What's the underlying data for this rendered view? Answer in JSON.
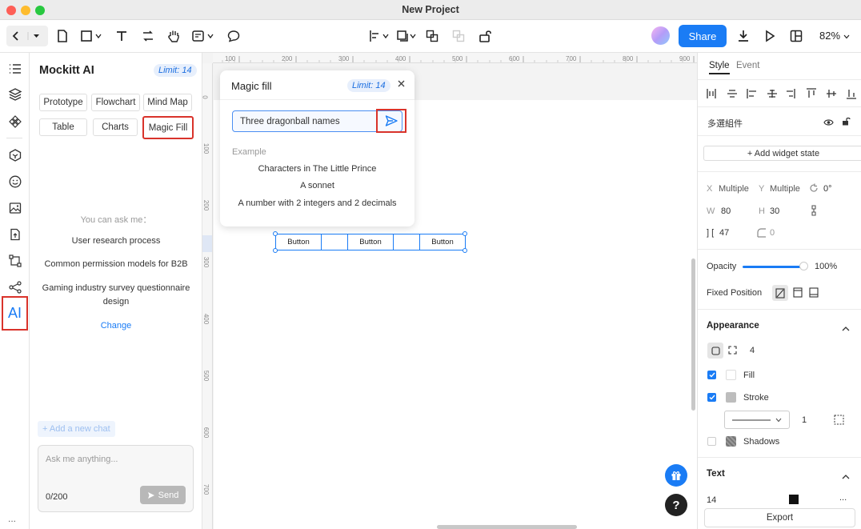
{
  "window": {
    "title": "New Project"
  },
  "toolbar": {
    "share_label": "Share",
    "zoom": "82%"
  },
  "ai_panel": {
    "title": "Mockitt AI",
    "limit": "Limit: 14",
    "tags": [
      "Prototype",
      "Flowchart",
      "Mind Map",
      "Table",
      "Charts",
      "Magic Fill"
    ],
    "hint_title": "You can ask me：",
    "suggestions": [
      "User research process",
      "Common permission models for B2B",
      "Gaming industry survey questionnaire",
      "design"
    ],
    "change_label": "Change",
    "new_chat": "+ Add a new chat",
    "chat_placeholder": "Ask me anything...",
    "char_count": "0/200",
    "send_label": "Send",
    "icon_label": "AI"
  },
  "ruler": {
    "h": [
      "100",
      "200",
      "300",
      "400",
      "500",
      "600",
      "700",
      "800",
      "900"
    ],
    "v": [
      "0",
      "100",
      "200",
      "300",
      "400",
      "500",
      "600",
      "700"
    ]
  },
  "magic_fill": {
    "title": "Magic fill",
    "limit": "Limit: 14",
    "input_value": "Three dragonball names",
    "example_label": "Example",
    "examples": [
      "Characters in The Little Prince",
      "A sonnet",
      "A number with 2 integers and 2 decimals"
    ]
  },
  "button_group": {
    "labels": [
      "Button",
      "",
      "Button",
      "",
      "Button"
    ]
  },
  "right_panel": {
    "tabs": [
      "Style",
      "Event"
    ],
    "component_name": "多選組件",
    "add_widget_state": "+ Add widget state",
    "x_label": "X",
    "x_value": "Multiple",
    "y_label": "Y",
    "y_value": "Multiple",
    "rotation": "0°",
    "w_label": "W",
    "w_value": "80",
    "h_label": "H",
    "h_value": "30",
    "spacing_label": "] [",
    "spacing_value": "47",
    "radius_value": "0",
    "opacity_label": "Opacity",
    "opacity_value": "100%",
    "fixed_position_label": "Fixed Position",
    "appearance_label": "Appearance",
    "corner_value": "4",
    "fill_label": "Fill",
    "stroke_label": "Stroke",
    "stroke_width": "1",
    "shadows_label": "Shadows",
    "text_label": "Text",
    "font_size": "14",
    "more_dots": "...",
    "export_label": "Export"
  },
  "fabs": {
    "help": "?"
  },
  "sidebar_bottom_dots": "..."
}
